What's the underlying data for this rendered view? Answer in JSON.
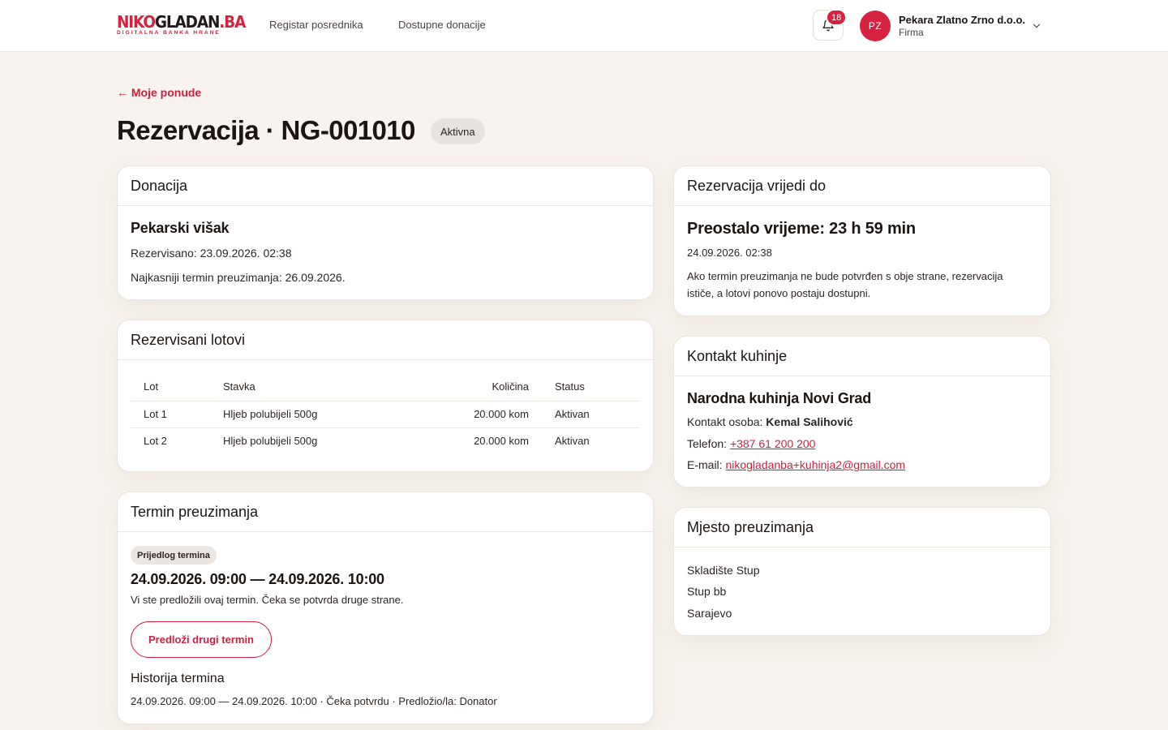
{
  "brand": {
    "logo_red": "NIKO",
    "logo_dark": "GLADAN",
    "logo_tail": ".BA",
    "tagline": "DIGITALNA BANKA HRANE"
  },
  "nav": {
    "items": [
      "Registar posrednika",
      "Dostupne donacije"
    ]
  },
  "header": {
    "notification_count": "18",
    "user": {
      "initials": "PZ",
      "name": "Pekara Zlatno Zrno d.o.o.",
      "role": "Firma"
    }
  },
  "page": {
    "back_label": "← Moje ponude",
    "title": "Rezervacija · NG-001010",
    "status": "Aktivna"
  },
  "donation": {
    "card_title": "Donacija",
    "name": "Pekarski višak",
    "reserved": "Rezervisano: 23.09.2026. 02:38",
    "latest_pickup": "Najkasniji termin preuzimanja: 26.09.2026."
  },
  "lots": {
    "card_title": "Rezervisani lotovi",
    "columns": [
      "Lot",
      "Stavka",
      "Količina",
      "Status"
    ],
    "rows": [
      {
        "lot": "Lot 1",
        "item": "Hljeb polubijeli 500g",
        "qty": "20.000 kom",
        "status": "Aktivan"
      },
      {
        "lot": "Lot 2",
        "item": "Hljeb polubijeli 500g",
        "qty": "20.000 kom",
        "status": "Aktivan"
      }
    ]
  },
  "pickup_term": {
    "card_title": "Termin preuzimanja",
    "badge": "Prijedlog termina",
    "range": "24.09.2026. 09:00 — 24.09.2026. 10:00",
    "note": "Vi ste predložili ovaj termin. Čeka se potvrda druge strane.",
    "button_label": "Predloži drugi termin",
    "history_title": "Historija termina",
    "history": [
      "24.09.2026. 09:00 — 24.09.2026. 10:00 · Čeka potvrdu · Predložio/la: Donator"
    ]
  },
  "validity": {
    "card_title": "Rezervacija vrijedi do",
    "remaining": "Preostalo vrijeme: 23 h 59 min",
    "date": "24.09.2026. 02:38",
    "note_line1": "Ako termin preuzimanja ne bude potvrđen s obje strane, rezervacija",
    "note_line2": "ističe, a lotovi ponovo postaju dostupni."
  },
  "contact": {
    "card_title": "Kontakt kuhinje",
    "kitchen_name": "Narodna kuhinja Novi Grad",
    "person_label": "Kontakt osoba: ",
    "person": "Kemal Salihović",
    "phone_label": "Telefon: ",
    "phone": "+387 61 200 200",
    "email_label": "E-mail: ",
    "email": "nikogladanba+kuhinja2@gmail.com"
  },
  "pickup_place": {
    "card_title": "Mjesto preuzimanja",
    "lines": [
      "Skladište Stup",
      "Stup bb",
      "Sarajevo"
    ]
  },
  "colors": {
    "brand_red": "#d5223e",
    "page_bg": "#f8f3ee",
    "card_bg": "#ffffff"
  },
  "icons": {
    "bell": "bell-icon",
    "chevron": "chevron-down-icon"
  }
}
